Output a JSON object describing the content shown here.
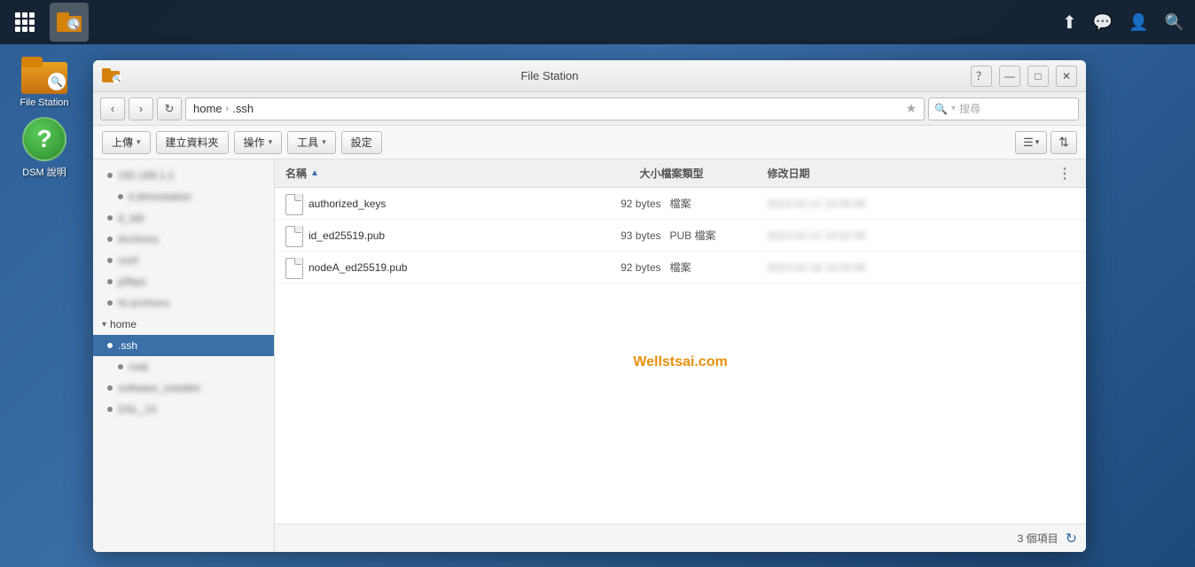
{
  "taskbar": {
    "apps_btn_label": "Apps",
    "file_station_app_label": "File Station"
  },
  "taskbar_right": {
    "upload_icon": "↑",
    "chat_icon": "💬",
    "user_icon": "👤",
    "search_icon": "🔍"
  },
  "desktop_icons": [
    {
      "id": "file-station",
      "label": "File Station"
    },
    {
      "id": "dsm-help",
      "label": "DSM 說明"
    }
  ],
  "window": {
    "title": "File Station",
    "nav_back": "‹",
    "nav_forward": "›",
    "refresh": "↻",
    "path_home": "home",
    "path_separator": "›",
    "path_ssh": ".ssh",
    "star": "★",
    "search_placeholder": "搜尋",
    "search_icon": "🔍",
    "controls": {
      "question": "？",
      "minimize": "—",
      "maximize": "□",
      "close": "✕"
    },
    "toolbar": {
      "upload": "上傳",
      "new_folder": "建立資料夾",
      "action": "操作",
      "tools": "工具",
      "settings": "設定"
    },
    "sidebar": {
      "items": [
        {
          "id": "item1",
          "label": "192.168.1.1",
          "blurred": true
        },
        {
          "id": "item2",
          "label": "it.drivestation",
          "blurred": true
        },
        {
          "id": "item3",
          "label": "d_lab",
          "blurred": true
        },
        {
          "id": "item4",
          "label": "Archives",
          "blurred": true
        },
        {
          "id": "item5",
          "label": "conf",
          "blurred": true
        },
        {
          "id": "item6",
          "label": "plfttps",
          "blurred": true
        },
        {
          "id": "item7",
          "label": "ht.archives",
          "blurred": true
        },
        {
          "id": "home-expand",
          "label": "home",
          "expandable": true
        },
        {
          "id": "ssh",
          "label": ".ssh",
          "active": true
        },
        {
          "id": "item8",
          "label": "mail",
          "blurred": true
        },
        {
          "id": "item9",
          "label": "software_installer",
          "blurred": true
        },
        {
          "id": "item10",
          "label": "DSL_14",
          "blurred": true
        }
      ]
    },
    "file_list": {
      "headers": {
        "name": "名稱",
        "size": "大小",
        "type": "檔案類型",
        "date": "修改日期"
      },
      "files": [
        {
          "name": "authorized_keys",
          "size": "92 bytes",
          "type": "檔案",
          "date": "2023-02-12 10:00:00"
        },
        {
          "name": "id_ed25519.pub",
          "size": "93 bytes",
          "type": "PUB 檔案",
          "date": "2023-02-12 10:02:00"
        },
        {
          "name": "nodeA_ed25519.pub",
          "size": "92 bytes",
          "type": "檔案",
          "date": "2023-02-18 15:00:00"
        }
      ]
    },
    "status": {
      "count_label": "3 個項目"
    },
    "watermark": "Wellstsai.com"
  }
}
